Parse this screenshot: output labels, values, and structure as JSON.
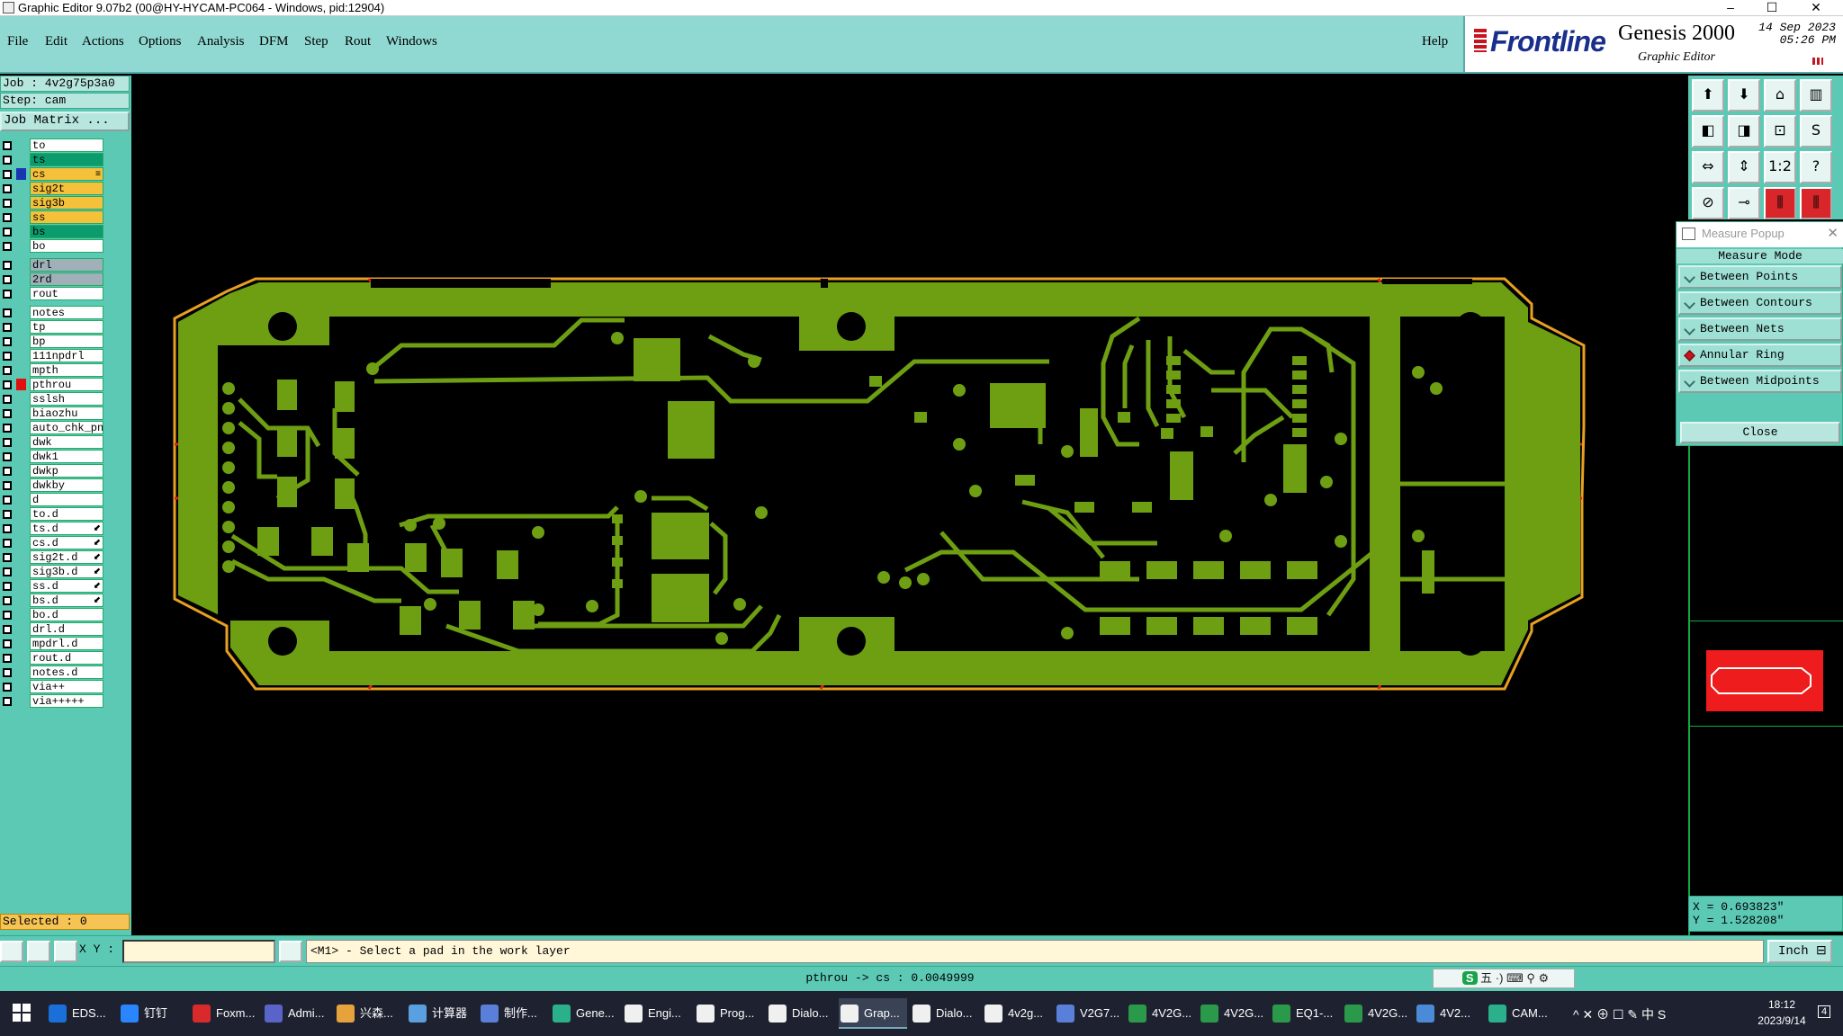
{
  "window": {
    "title": "Graphic Editor 9.07b2 (00@HY-HYCAM-PC064 - Windows, pid:12904)",
    "minimize": "–",
    "maximize": "☐",
    "close": "✕"
  },
  "menu": [
    "File",
    "Edit",
    "Actions",
    "Options",
    "Analysis",
    "DFM",
    "Step",
    "Rout",
    "Windows"
  ],
  "help": "Help",
  "logo": {
    "brand": "Frontline",
    "product": "Genesis 2000",
    "subtitle": "Graphic Editor",
    "date": "14 Sep 2023",
    "time": "05:26 PM"
  },
  "job": {
    "job_line": "Job : 4v2g75p3a0",
    "step_line": "Step: cam",
    "matrix_button": "Job Matrix ..."
  },
  "layers": [
    {
      "name": "to",
      "color": "#ffffff"
    },
    {
      "name": "ts",
      "color": "#0b9b6c"
    },
    {
      "name": "cs",
      "color": "#f5c03a",
      "mark": "#1836b0",
      "suffix": "≡"
    },
    {
      "name": "sig2t",
      "color": "#f5c03a"
    },
    {
      "name": "sig3b",
      "color": "#f5c03a"
    },
    {
      "name": "ss",
      "color": "#f5c03a"
    },
    {
      "name": "bs",
      "color": "#0b9b6c"
    },
    {
      "name": "bo",
      "color": "#ffffff"
    },
    {
      "name": "drl",
      "color": "#9fb0b8"
    },
    {
      "name": "2rd",
      "color": "#9fb0b8"
    },
    {
      "name": "rout",
      "color": "#ffffff"
    },
    {
      "name": "notes",
      "color": "#ffffff"
    },
    {
      "name": "tp",
      "color": "#ffffff"
    },
    {
      "name": "bp",
      "color": "#ffffff"
    },
    {
      "name": "111npdrl",
      "color": "#ffffff"
    },
    {
      "name": "mpth",
      "color": "#ffffff"
    },
    {
      "name": "pthrou",
      "color": "#ffffff",
      "mark": "#e01010"
    },
    {
      "name": "sslsh",
      "color": "#ffffff"
    },
    {
      "name": "biaozhu",
      "color": "#ffffff"
    },
    {
      "name": "auto_chk_pn",
      "color": "#ffffff"
    },
    {
      "name": "dwk",
      "color": "#ffffff"
    },
    {
      "name": "dwk1",
      "color": "#ffffff"
    },
    {
      "name": "dwkp",
      "color": "#ffffff"
    },
    {
      "name": "dwkby",
      "color": "#ffffff"
    },
    {
      "name": "d",
      "color": "#ffffff"
    },
    {
      "name": "to.d",
      "color": "#ffffff"
    },
    {
      "name": "ts.d",
      "color": "#ffffff",
      "suffix": "⬋"
    },
    {
      "name": "cs.d",
      "color": "#ffffff",
      "suffix": "⬋"
    },
    {
      "name": "sig2t.d",
      "color": "#ffffff",
      "suffix": "⬋"
    },
    {
      "name": "sig3b.d",
      "color": "#ffffff",
      "suffix": "⬋"
    },
    {
      "name": "ss.d",
      "color": "#ffffff",
      "suffix": "⬋"
    },
    {
      "name": "bs.d",
      "color": "#ffffff",
      "suffix": "⬋"
    },
    {
      "name": "bo.d",
      "color": "#ffffff"
    },
    {
      "name": "drl.d",
      "color": "#ffffff"
    },
    {
      "name": "mpdrl.d",
      "color": "#ffffff"
    },
    {
      "name": "rout.d",
      "color": "#ffffff"
    },
    {
      "name": "notes.d",
      "color": "#ffffff"
    },
    {
      "name": "via++",
      "color": "#ffffff"
    },
    {
      "name": "via+++++",
      "color": "#ffffff"
    }
  ],
  "selected": "Selected : 0",
  "measure": {
    "title": "Measure Popup",
    "header": "Measure Mode",
    "options": [
      "Between Points",
      "Between Contours",
      "Between Nets",
      "Annular Ring",
      "Between Midpoints"
    ],
    "selected_index": 3,
    "close": "Close"
  },
  "coords": {
    "x": "X = 0.693823\"",
    "y": "Y = 1.528208\""
  },
  "bottom": {
    "xy_label": "X Y :",
    "xy_value": "",
    "prompt": "<M1> - Select a pad in the work layer",
    "unit": "Inch ⊟"
  },
  "status_line": "pthrou -> cs : 0.0049999",
  "ime": {
    "s": "S",
    "text": "五 ·) ⌨ ⚲ ⚙"
  },
  "taskbar": {
    "items": [
      "EDS...",
      "钉钉",
      "Foxm...",
      "Admi...",
      "兴森...",
      "计算器",
      "制作...",
      "Gene...",
      "Engi...",
      "Prog...",
      "Dialo...",
      "Grap...",
      "Dialo...",
      "4v2g...",
      "V2G7...",
      "4V2G...",
      "4V2G...",
      "EQ1-...",
      "4V2G...",
      "4V2...",
      "CAM..."
    ],
    "active_index": 11,
    "icon_colors": [
      "#1a6fd8",
      "#2a86ff",
      "#d82a2a",
      "#5a63c8",
      "#e6a23c",
      "#5aa0e0",
      "#5a7fd8",
      "#2ab08a",
      "#f0f0f0",
      "#f0f0f0",
      "#f0f0f0",
      "#f0f0f0",
      "#f0f0f0",
      "#f0f0f0",
      "#5a7fd8",
      "#2a9a4a",
      "#2a9a4a",
      "#2a9a4a",
      "#2a9a4a",
      "#4a8ad8",
      "#2ab08a"
    ],
    "tray": "^ ✕ ⊕ ☐ ✎ 中 S",
    "time": "18:12",
    "date": "2023/9/14",
    "notify": "4"
  }
}
